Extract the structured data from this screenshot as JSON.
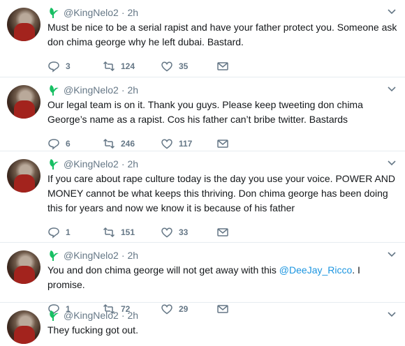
{
  "tweets": [
    {
      "handle": "@KingNelo2",
      "separator": "·",
      "time": "2h",
      "text": "Must be nice to be a serial rapist and have your father protect you. Someone ask don chima george why he left dubai. Bastard.",
      "replies": "3",
      "retweets": "124",
      "likes": "35"
    },
    {
      "handle": "@KingNelo2",
      "separator": "·",
      "time": "2h",
      "text": "Our legal team is on it. Thank you guys. Please keep tweeting don chima George’s name as a rapist. Cos his father can’t bribe twitter. Bastards",
      "replies": "6",
      "retweets": "246",
      "likes": "117"
    },
    {
      "handle": "@KingNelo2",
      "separator": "·",
      "time": "2h",
      "text": "If you care about rape culture today is the day you use your voice. POWER AND MONEY cannot be what keeps this thriving. Don chima george has been doing this for years and now we know it is because of his father",
      "replies": "1",
      "retweets": "151",
      "likes": "33"
    },
    {
      "handle": "@KingNelo2",
      "separator": "·",
      "time": "2h",
      "text_before": "You and don chima george will not get away with this ",
      "mention": "@DeeJay_Ricco",
      "text_after": ". I promise.",
      "replies": "1",
      "retweets": "72",
      "likes": "29"
    },
    {
      "handle": "@KingNelo2",
      "separator": "·",
      "time": "2h",
      "text": "They fucking got out."
    }
  ],
  "colors": {
    "secondary": "#657786",
    "link": "#1b95e0",
    "badge": "#17bf63",
    "border": "#e6ecf0"
  },
  "icons": [
    "verified-leaf-icon",
    "caret-down-icon",
    "reply-icon",
    "retweet-icon",
    "like-icon",
    "message-icon"
  ]
}
